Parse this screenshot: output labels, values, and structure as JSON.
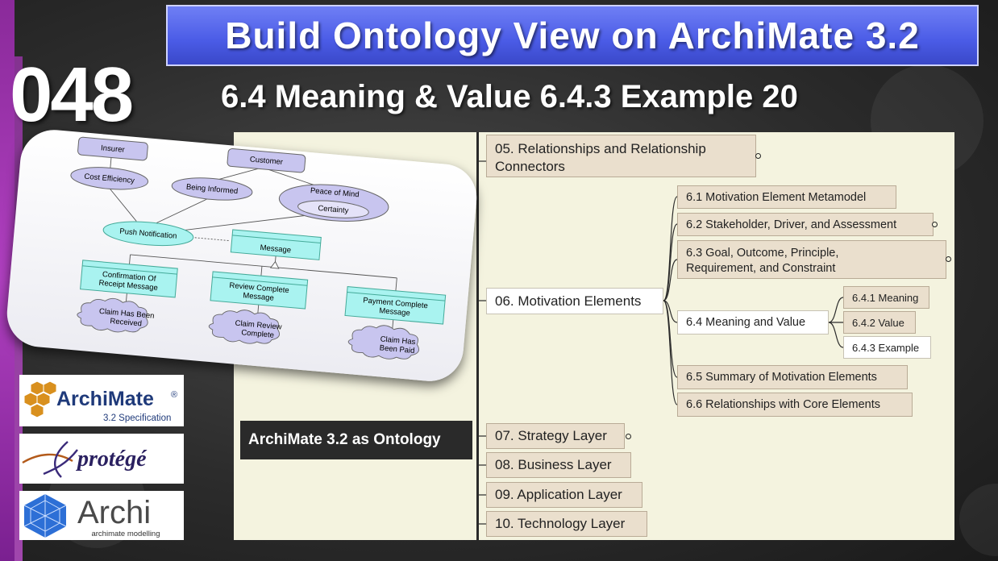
{
  "banner": {
    "title": "Build Ontology View on ArchiMate 3.2"
  },
  "episode": "048",
  "subtitle": "6.4 Meaning & Value 6.4.3 Example 20",
  "mindmap": {
    "root": "ArchiMate 3.2 as Ontology",
    "n05": [
      "05. Relationships and Relationship",
      "Connectors"
    ],
    "n06": "06. Motivation Elements",
    "n61": "6.1 Motivation Element Metamodel",
    "n62": "6.2 Stakeholder, Driver, and Assessment",
    "n63": [
      "6.3 Goal, Outcome, Principle,",
      "Requirement, and Constraint"
    ],
    "n64": "6.4 Meaning and Value",
    "n641": "6.4.1 Meaning",
    "n642": "6.4.2 Value",
    "n643": "6.4.3 Example",
    "n65": "6.5 Summary of Motivation Elements",
    "n66": "6.6 Relationships with Core Elements",
    "n07": "07. Strategy Layer",
    "n08": "08. Business Layer",
    "n09": "09. Application Layer",
    "n10": "10. Technology Layer"
  },
  "diagram": {
    "insurer": "Insurer",
    "customer": "Customer",
    "cost_efficiency": "Cost Efficiency",
    "being_informed": "Being Informed",
    "peace_of_mind": "Peace of Mind",
    "certainty": "Certainty",
    "push_notification": "Push Notification",
    "message": "Message",
    "confirmation": [
      "Confirmation Of",
      "Receipt Message"
    ],
    "review_complete": [
      "Review Complete",
      "Message"
    ],
    "payment_complete": [
      "Payment Complete",
      "Message"
    ],
    "claim_received": [
      "Claim Has Been",
      "Received"
    ],
    "claim_review": [
      "Claim Review",
      "Complete"
    ],
    "claim_paid": [
      "Claim Has",
      "Been Paid"
    ]
  },
  "logos": {
    "archimate_name": "ArchiMate",
    "archimate_reg": "®",
    "archimate_spec": "3.2 Specification",
    "protege": "protégé",
    "archi": "Archi",
    "archi_tag": "archimate modelling"
  },
  "colors": {
    "banner_blue": "#4a5be6",
    "node_fill": "#eadfcd",
    "panel_bg": "#f4f3df",
    "diagram_cyan": "#a9f3f0",
    "diagram_lavender": "#c8c5ef",
    "archimate_orange": "#d9901e",
    "archi_blue": "#2d6fd6"
  }
}
